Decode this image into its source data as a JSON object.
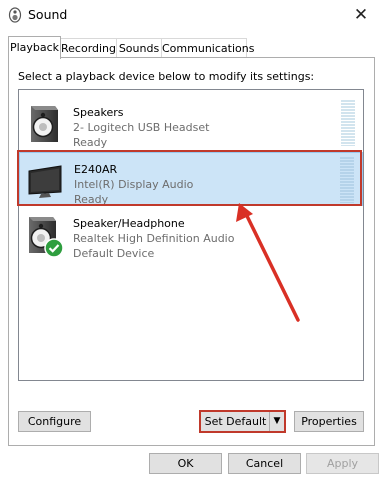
{
  "window": {
    "title": "Sound",
    "close_glyph": "✕"
  },
  "tabs": [
    {
      "label": "Playback",
      "active": true
    },
    {
      "label": "Recording"
    },
    {
      "label": "Sounds"
    },
    {
      "label": "Communications"
    }
  ],
  "instruction": "Select a playback device below to modify its settings:",
  "devices": [
    {
      "name": "Speakers",
      "description": "2- Logitech USB Headset",
      "status": "Ready",
      "icon": "speaker-icon"
    },
    {
      "name": "E240AR",
      "description": "Intel(R) Display Audio",
      "status": "Ready",
      "icon": "monitor-icon",
      "selected": true
    },
    {
      "name": "Speaker/Headphone",
      "description": "Realtek High Definition Audio",
      "status": "Default Device",
      "icon": "speaker-icon",
      "default_badge": "check-icon"
    }
  ],
  "buttons": {
    "configure": "Configure",
    "set_default": "Set Default",
    "dropdown_glyph": "▼",
    "properties": "Properties",
    "ok": "OK",
    "cancel": "Cancel",
    "apply": "Apply"
  },
  "colors": {
    "highlight": "#c0392b",
    "selection": "#cce4f7",
    "default_check": "#2e9e3f"
  }
}
